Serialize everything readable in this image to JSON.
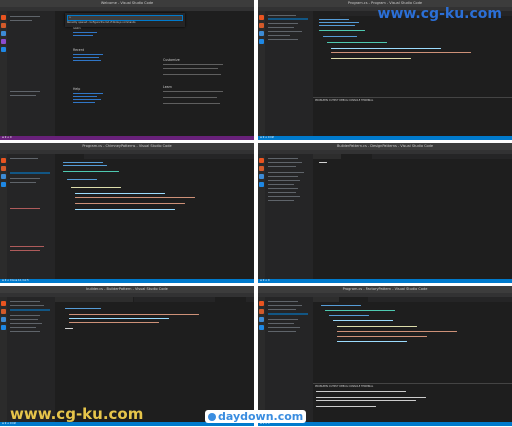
{
  "watermarks": {
    "top": "www.cg-ku.com",
    "bottom": "www.cg-ku.com",
    "daydown": "daydown.com"
  },
  "pane1": {
    "title": "Welcome - Visual Studio Code",
    "command_input": ">",
    "command_option": "Recently opened: configure the list of Node.js commands",
    "welcome_sections": [
      "Start",
      "Recent",
      "Help",
      "Customize",
      "Learn"
    ],
    "status": "⊗ 0 ⚠ 0"
  },
  "pane2": {
    "title": "Program.cs - Program - Visual Studio Code",
    "panel_tabs": "PROBLEMS  OUTPUT  DEBUG CONSOLE  TERMINAL",
    "status": "⊗ 0 ⚠ 0  C#"
  },
  "pane3": {
    "title": "Program.cs - ChimneyPatterns - Visual Studio Code",
    "status": "⊗ 0 ⚠ 0  Line 12, Col 5"
  },
  "pane4": {
    "title": "BuilderPattern.cs - DesignPatterns - Visual Studio Code",
    "status": "⊗ 0 ⚠ 0"
  },
  "pane5": {
    "title": "builder.cs - BuilderPattern - Visual Studio Code",
    "status": "⊗ 0 ⚠ 0  C#"
  },
  "pane6": {
    "title": "Program.cs - FactoryPattern - Visual Studio Code",
    "panel_tabs": "PROBLEMS  OUTPUT  DEBUG CONSOLE  TERMINAL",
    "status": "⊗ 0 ⚠ 0"
  },
  "colors": {
    "editor_bg": "#1e1e1e",
    "statusbar": "#007acc",
    "keyword": "#569cd6",
    "type": "#4ec9b0",
    "string": "#ce9178"
  }
}
